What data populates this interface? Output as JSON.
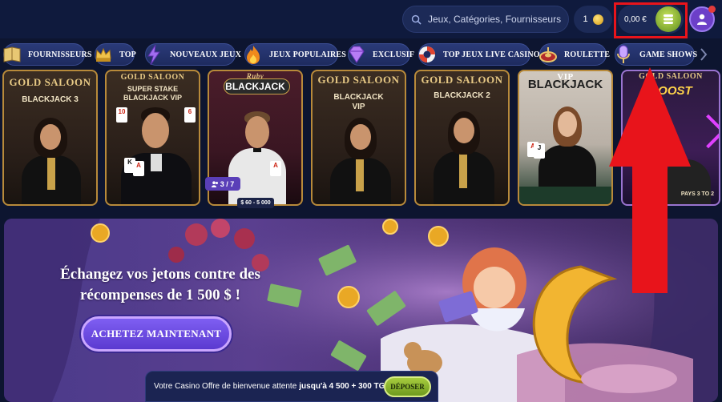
{
  "header": {
    "search_placeholder": "Jeux, Catégories, Fournisseurs",
    "coins_count": "1",
    "balance": "0,00 €"
  },
  "nav": {
    "items": [
      {
        "label": "FOURNISSEURS",
        "icon": "book-icon"
      },
      {
        "label": "TOP",
        "icon": "crown-icon"
      },
      {
        "label": "NOUVEAUX JEUX",
        "icon": "lightning-icon"
      },
      {
        "label": "JEUX POPULAIRES",
        "icon": "fire-icon"
      },
      {
        "label": "EXCLUSIF",
        "icon": "diamond-icon"
      },
      {
        "label": "TOP JEUX LIVE CASINO",
        "icon": "lifebuoy-icon"
      },
      {
        "label": "ROULETTE",
        "icon": "roulette-icon"
      },
      {
        "label": "GAME SHOWS",
        "icon": "microphone-icon"
      }
    ]
  },
  "tiles": [
    {
      "line1": "GOLD SALOON",
      "line2": "BLACKJACK 3"
    },
    {
      "line1": "GOLD SALOON",
      "line2": "SUPER STAKE",
      "line3": "BLACKJACK VIP"
    },
    {
      "line1": "Ruby",
      "line2": "BLACKJACK",
      "players": "3 / 7",
      "limits": "$ 60 - 5 000"
    },
    {
      "line1": "GOLD SALOON",
      "line2": "BLACKJACK",
      "line3": "VIP"
    },
    {
      "line1": "GOLD SALOON",
      "line2": "BLACKJACK 2"
    },
    {
      "line1": "VIP",
      "line2": "BLACKJACK"
    },
    {
      "line1": "GOLD SALOON",
      "line2": "BOOST",
      "line3": "PAYS 3 TO 2"
    }
  ],
  "hero": {
    "title": "Échangez vos jetons contre des récompenses de 1 500 $ !",
    "button": "ACHETEZ MAINTENANT"
  },
  "welcome": {
    "text": "Votre Casino Offre de bienvenue attente",
    "highlight": "jusqu'à 4 500 + 300 TG",
    "button": "DÉPOSER"
  },
  "colors": {
    "annotation": "#e8141b",
    "accent_purple": "#6a4be0",
    "deposit_green": "#8fb630"
  }
}
